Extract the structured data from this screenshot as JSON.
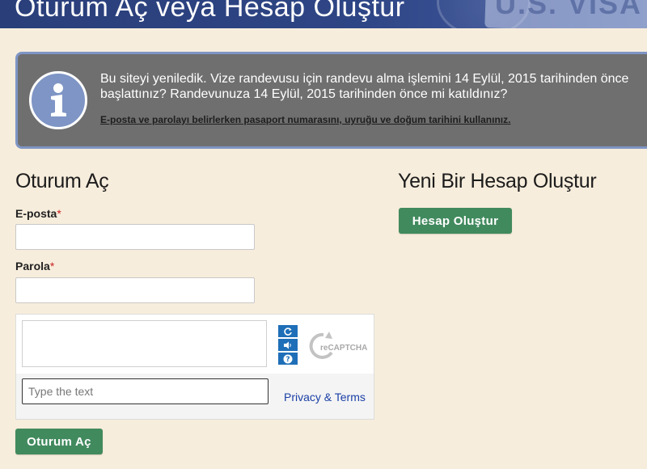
{
  "header": {
    "title": "Oturum Aç veya Hesap Oluştur",
    "visa_text": "U.S. VISA"
  },
  "alert": {
    "icon": "info-icon",
    "line1": "Bu siteyi yeniledik. Vize randevusu için randevu alma işlemini 14 Eylül, 2015 tarihinden önce",
    "line2": "başlattınız? Randevunuza 14 Eylül, 2015 tarihinden önce mi katıldınız?",
    "link": "E-posta ve parolayı belirlerken pasaport numarasını, uyruğu ve doğum tarihini kullanınız."
  },
  "signin": {
    "title": "Oturum Aç",
    "email_label": "E-posta",
    "email_value": "",
    "password_label": "Parola",
    "password_value": "",
    "required_mark": "*",
    "submit_label": "Oturum Aç"
  },
  "captcha": {
    "placeholder": "Type the text",
    "privacy_label": "Privacy & Terms",
    "logo_text": "reCAPTCHA",
    "tools": [
      "refresh-icon",
      "audio-icon",
      "help-icon"
    ]
  },
  "register": {
    "title": "Yeni Bir Hesap Oluştur",
    "button_label": "Hesap Oluştur"
  },
  "colors": {
    "background": "#f7eddc",
    "header": "#2e4585",
    "alert_bg": "#6f6f6f",
    "alert_border": "#7e95c5",
    "button": "#418a5e",
    "link": "#1a3fa6",
    "required": "#cc2222"
  }
}
